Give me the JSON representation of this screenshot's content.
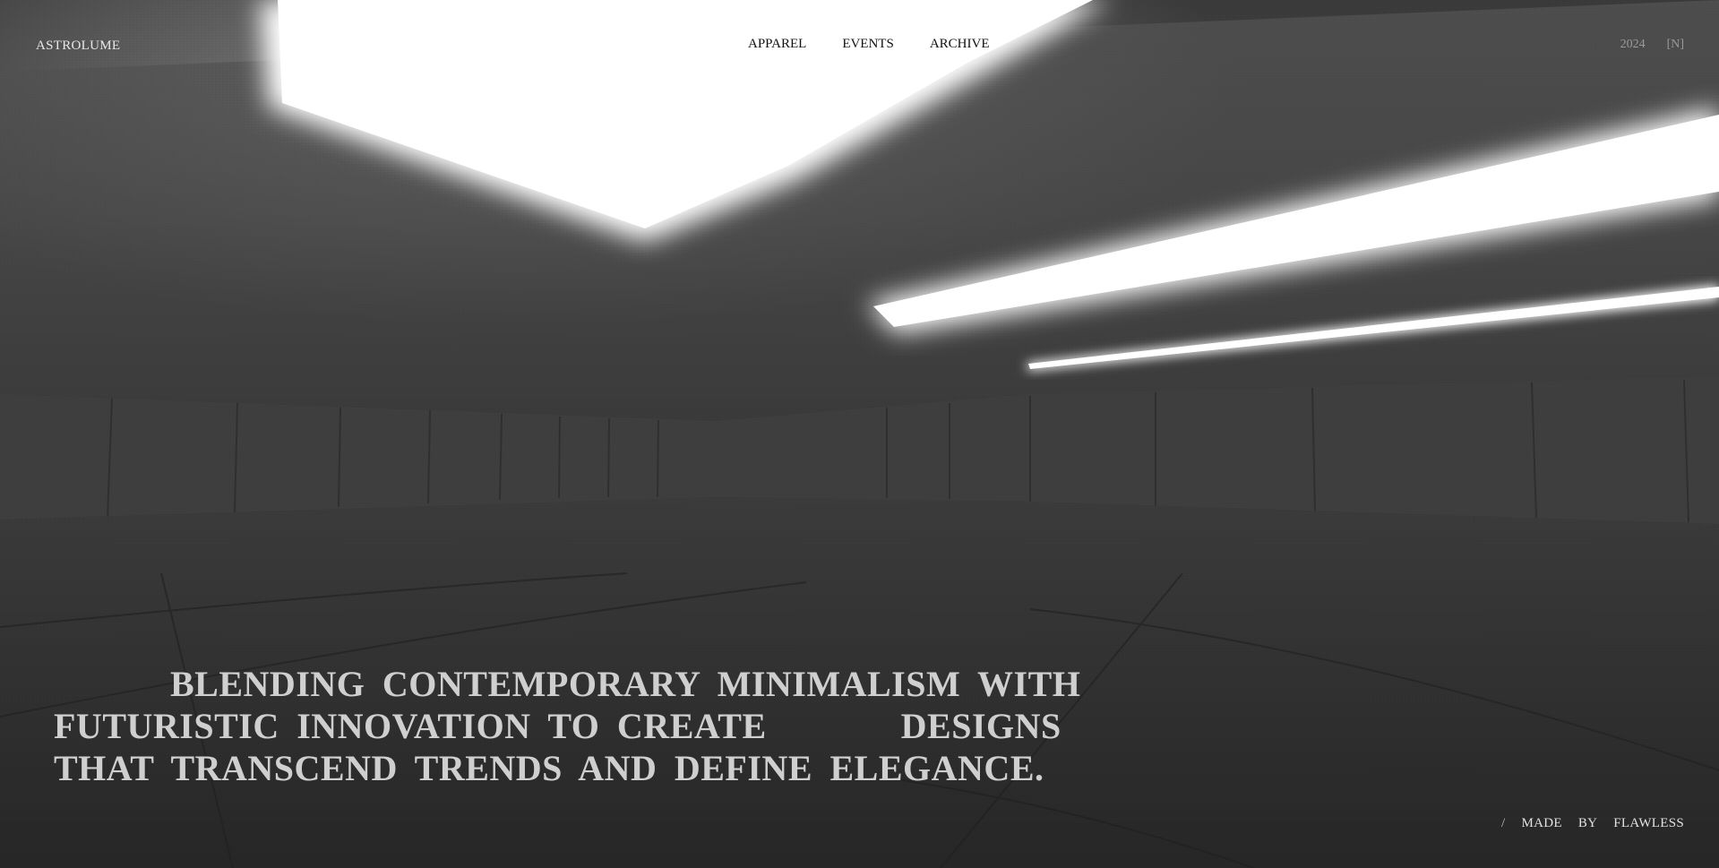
{
  "header": {
    "brand": "ASTROLUME",
    "nav": [
      {
        "label": "APPAREL"
      },
      {
        "label": "EVENTS"
      },
      {
        "label": "ARCHIVE"
      }
    ],
    "year": "2024",
    "badge": "[N]"
  },
  "hero": {
    "line1": "BLENDING CONTEMPORARY MINIMALISM WITH",
    "line2_start": "FUTURISTIC INNOVATION TO CREATE",
    "line2_end": "DESIGNS",
    "line3": "THAT TRANSCEND TRENDS AND DEFINE ELEGANCE."
  },
  "footer": {
    "slash": "/",
    "made": "MADE",
    "by": "BY",
    "author": "FLAWLESS"
  },
  "colors": {
    "background": "#2b2b2b",
    "text_light": "#d9d9d9",
    "nav_text": "#111111",
    "light_panel": "#ffffff"
  },
  "icons": {
    "background_scene": "concrete-room-with-light-panels"
  }
}
